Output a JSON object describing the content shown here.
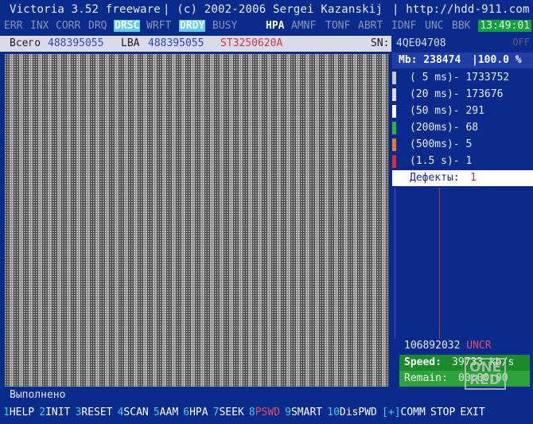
{
  "title": {
    "app": "Victoria 3.52 freeware",
    "copyright": "| (c) 2002-2006",
    "author": "Sergei Kazanskij",
    "site": "| http://hdd-911.com"
  },
  "status_flags": {
    "err": "ERR",
    "inx": "INX",
    "corr": "CORR",
    "drq": "DRQ",
    "drsc": "DRSC",
    "wrft": "WRFT",
    "drdy": "DRDY",
    "busy": "BUSY",
    "hpa": "HPA",
    "amnf": "AMNF",
    "tonf": "TONF",
    "abrt": "ABRT",
    "idnf": "IDNF",
    "unc": "UNC",
    "bbk": "BBK"
  },
  "clock": "13:49:01",
  "off_label": "OFF",
  "info": {
    "total_label": "Всего",
    "total_value": "488395055",
    "lba_label": "LBA",
    "lba_value": "488395055",
    "model": "ST3250620A",
    "sn_label": "SN:",
    "sn_value": "4QE04708"
  },
  "mb_line": {
    "mb": "Mb: 238474",
    "percent": "|100.0 %"
  },
  "timings": [
    {
      "label": "( 5 ms)-",
      "count": "1733752",
      "color": "#c8c8c8"
    },
    {
      "label": "(20 ms)-",
      "count": "173676",
      "color": "#dcdcdc"
    },
    {
      "label": "(50 ms)-",
      "count": "291",
      "color": "#ffffff"
    },
    {
      "label": "(200ms)-",
      "count": "68",
      "color": "#2ab43c"
    },
    {
      "label": "(500ms)-",
      "count": "5",
      "color": "#e8782a"
    },
    {
      "label": "(1.5 s)-",
      "count": "1",
      "color": "#e02a3a"
    }
  ],
  "defects": {
    "label": "Дефекты:",
    "value": "1"
  },
  "uncr": {
    "value": "106892032",
    "label": "UNCR"
  },
  "speed": {
    "label": "Speed:",
    "value": "39733 kb/s"
  },
  "remain": {
    "label": "Remain:",
    "value": "00:00:00"
  },
  "watermark": {
    "line1": "ONE",
    "line2": "RED"
  },
  "message": "Выполнено",
  "fkeys": [
    {
      "n": "1",
      "label": "HELP"
    },
    {
      "n": "2",
      "label": "INIT"
    },
    {
      "n": "3",
      "label": "RESET"
    },
    {
      "n": "4",
      "label": "SCAN"
    },
    {
      "n": "5",
      "label": "AAM"
    },
    {
      "n": "6",
      "label": "HPA"
    },
    {
      "n": "7",
      "label": "SEEK"
    },
    {
      "n": "8",
      "label": "PSWD"
    },
    {
      "n": "9",
      "label": "SMART"
    },
    {
      "n": "10",
      "label": "DisPWD"
    },
    {
      "n": "[+]",
      "label": "COMM"
    },
    {
      "n": "",
      "label": "STOP"
    },
    {
      "n": "",
      "label": "EXIT"
    }
  ]
}
